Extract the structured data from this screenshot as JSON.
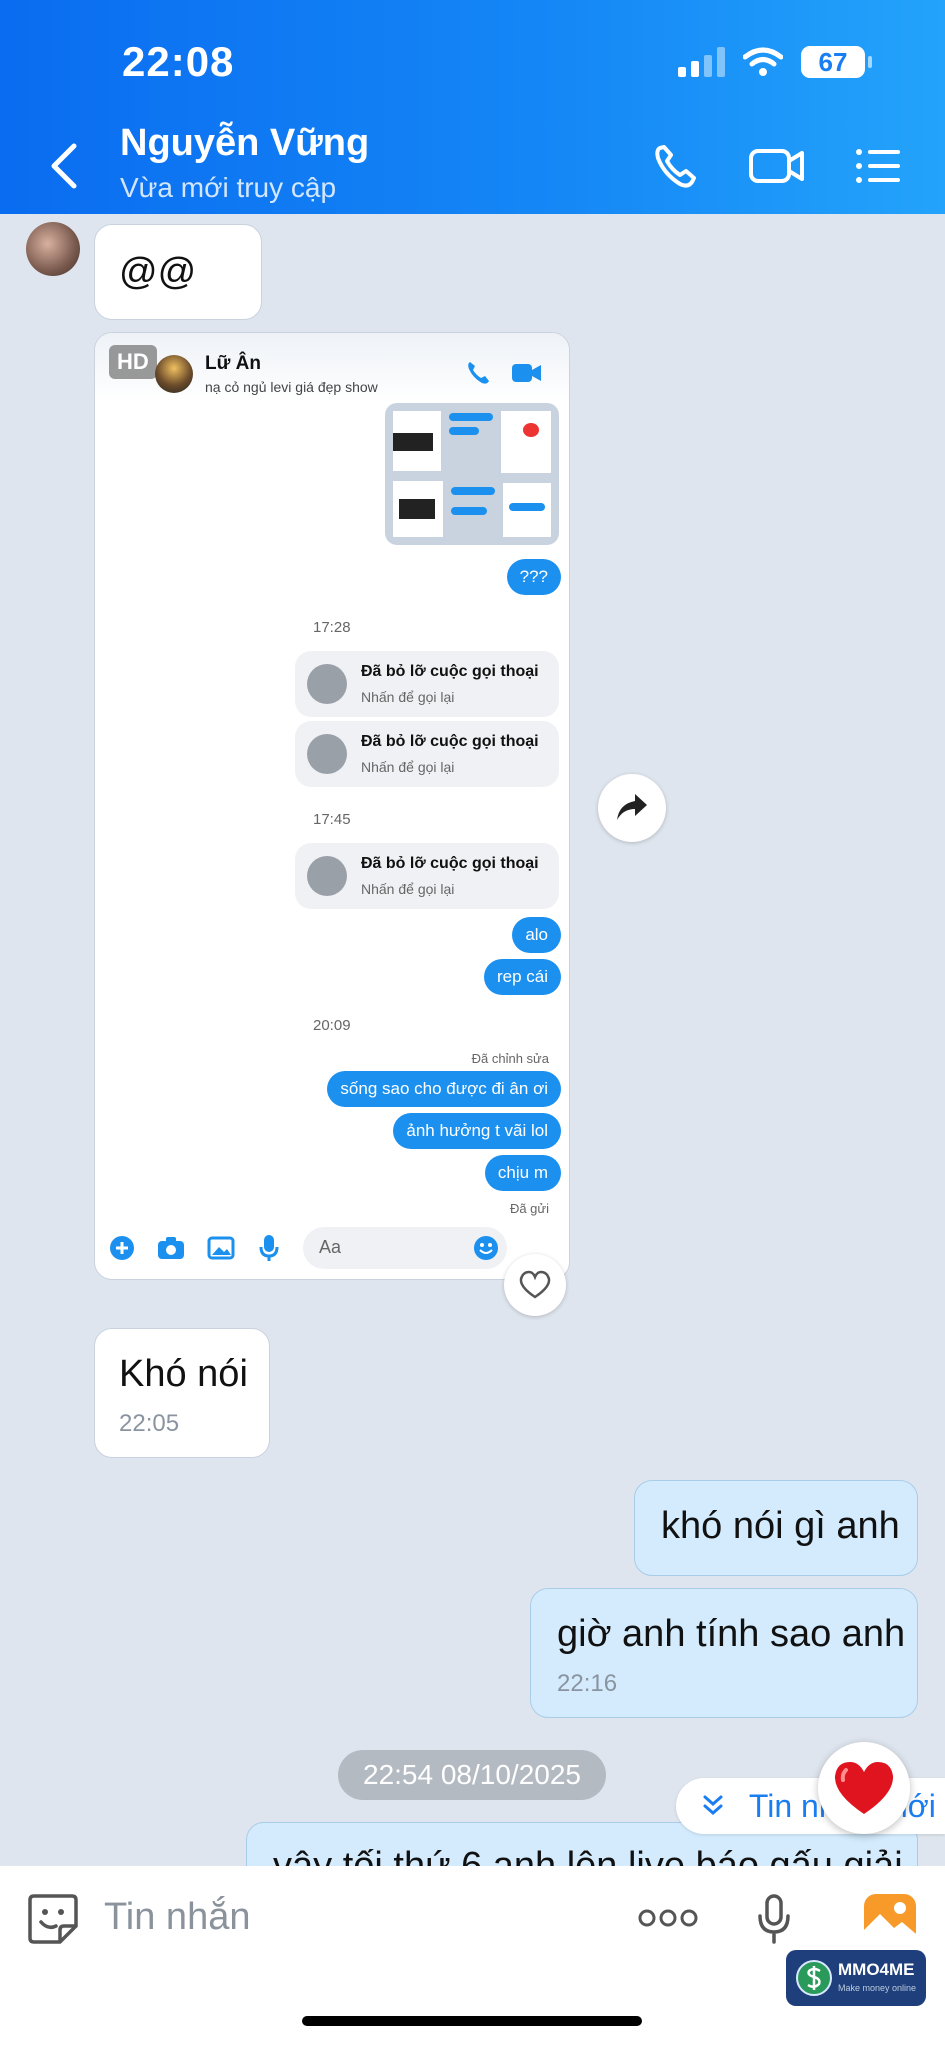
{
  "status_bar": {
    "time": "22:08",
    "battery": "67"
  },
  "header": {
    "name": "Nguyễn Vững",
    "status": "Vừa mới truy cập"
  },
  "messages": {
    "m1": {
      "text": "@@"
    },
    "m2": {
      "text": "Khó nói",
      "time": "22:05"
    },
    "m3": {
      "text": "khó nói gì anh"
    },
    "m4": {
      "text": "giờ anh tính sao anh",
      "time": "22:16"
    },
    "m5": {
      "text": "vậy tối thứ 6 anh lên live báo gấu giải"
    }
  },
  "screenshot": {
    "hd_badge": "HD",
    "name": "Lữ Ân",
    "sub": "nạ cỏ ngủ levi giá đẹp show",
    "q": "???",
    "time1": "17:28",
    "time2": "17:45",
    "time3": "20:09",
    "missed_title": "Đã bỏ lỡ cuộc gọi thoại",
    "missed_sub": "Nhấn để gọi lại",
    "alo": "alo",
    "rep": "rep cái",
    "edited": "Đã chỉnh sửa",
    "b1": "sống sao cho được đi ân ơi",
    "b2": "ảnh hưởng t vãi lol",
    "b3": "chịu m",
    "sent": "Đã gửi",
    "input_placeholder": "Aa"
  },
  "date_chip": "22:54 08/10/2025",
  "new_messages": "Tin nhắn mới",
  "composer": {
    "placeholder": "Tin nhắn"
  },
  "watermark": {
    "title": "MMO4ME",
    "sub": "Make money online"
  },
  "colors": {
    "header_blue": "#1588f6",
    "outgoing_bubble": "#d3ebfd",
    "accent": "#1a7ef2"
  },
  "icons": [
    "back-icon",
    "phone-icon",
    "video-icon",
    "menu-list-icon",
    "share-icon",
    "heart-icon",
    "sticker-icon",
    "more-icon",
    "mic-icon",
    "gallery-icon"
  ]
}
